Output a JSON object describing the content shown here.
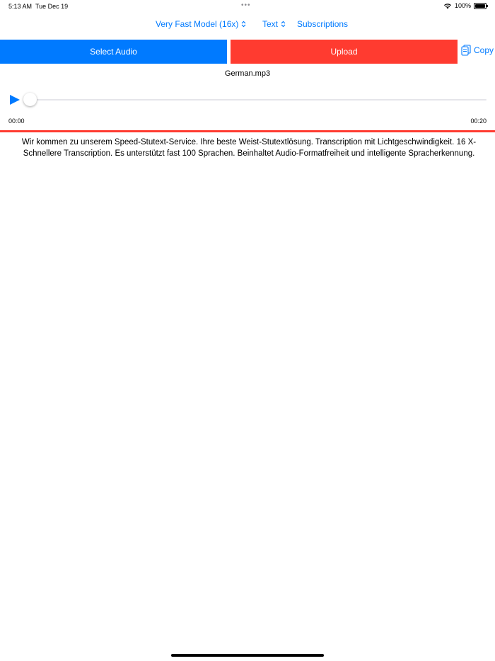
{
  "status_bar": {
    "time": "5:13 AM",
    "date": "Tue Dec 19",
    "battery": "100%"
  },
  "nav": {
    "model": "Very Fast Model (16x)",
    "format": "Text",
    "subscriptions": "Subscriptions"
  },
  "buttons": {
    "select_audio": "Select Audio",
    "upload": "Upload",
    "copy": "Copy"
  },
  "player": {
    "file_name": "German.mp3",
    "current_time": "00:00",
    "duration": "00:20",
    "progress": 0
  },
  "transcript": {
    "text": "Wir kommen zu unserem Speed-Stutext-Service.  Ihre beste Weist-Stutextlösung.  Transcription mit Lichtgeschwindigkeit.  16 X-Schnellere Transcription.  Es unterstützt fast 100 Sprachen.  Beinhaltet Audio-Formatfreiheit und intelligente Spracherkennung."
  },
  "colors": {
    "accent_blue": "#007aff",
    "accent_red": "#ff3b30"
  },
  "icons": {
    "wifi": "wifi-icon",
    "battery": "battery-icon",
    "copy": "copy-icon",
    "play": "play-icon",
    "chevron": "chevron-up-down-icon"
  }
}
